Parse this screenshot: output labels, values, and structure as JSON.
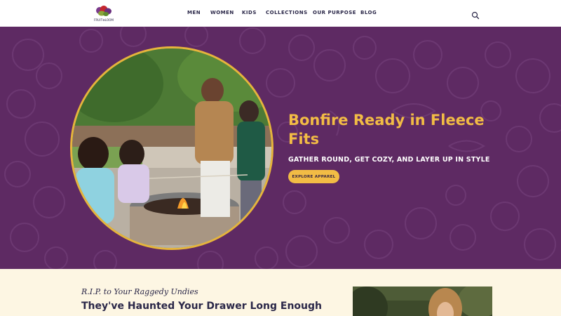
{
  "header": {
    "logo_alt": "Fruit of the Loom",
    "nav": [
      {
        "label": "MEN"
      },
      {
        "label": "WOMEN"
      },
      {
        "label": "KIDS"
      },
      {
        "label": "COLLECTIONS"
      },
      {
        "label": "OUR PURPOSE"
      },
      {
        "label": "BLOG"
      }
    ],
    "search_icon": "search-icon"
  },
  "hero": {
    "title": "Bonfire Ready in Fleece Fits",
    "subtitle": "GATHER ROUND, GET COZY, AND LAYER UP IN STYLE",
    "cta_label": "EXPLORE APPAREL",
    "background_color": "#5e2a63",
    "accent_color": "#f2bc45",
    "photo_alt": "Family roasting marshmallows around a fire pit"
  },
  "promo": {
    "eyebrow": "R.I.P. to Your Raggedy Undies",
    "title": "They've Haunted Your Drawer Long Enough",
    "photo_alt": "Woman in garden"
  }
}
